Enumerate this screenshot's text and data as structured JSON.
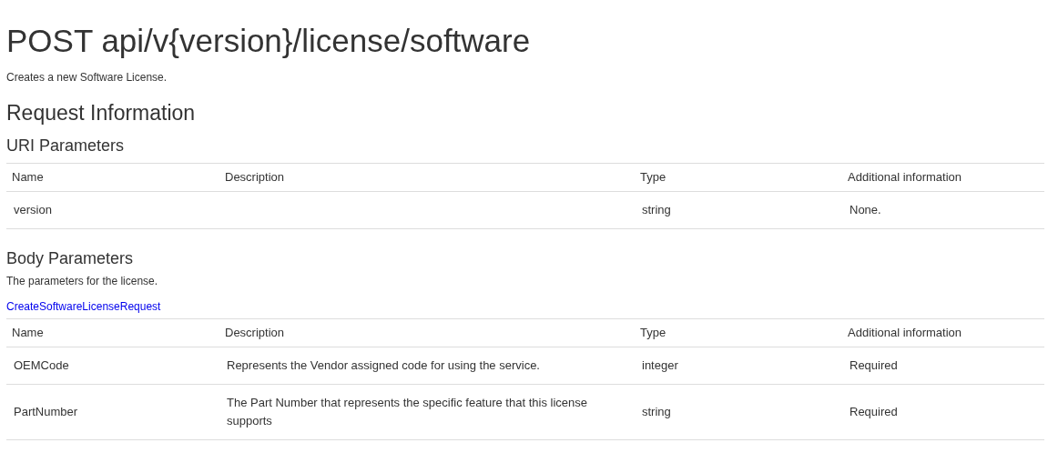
{
  "title": "POST api/v{version}/license/software",
  "description": "Creates a new Software License.",
  "request_heading": "Request Information",
  "uri_parameters": {
    "heading": "URI Parameters",
    "columns": [
      "Name",
      "Description",
      "Type",
      "Additional information"
    ],
    "rows": [
      [
        "version",
        "",
        "string",
        "None."
      ]
    ]
  },
  "body_parameters": {
    "heading": "Body Parameters",
    "description": "The parameters for the license.",
    "type_link": "CreateSoftwareLicenseRequest",
    "columns": [
      "Name",
      "Description",
      "Type",
      "Additional information"
    ],
    "rows": [
      [
        "OEMCode",
        "Represents the Vendor assigned code for using the service.",
        "integer",
        "Required"
      ],
      [
        "PartNumber",
        "The Part Number that represents the specific feature that this license supports",
        "string",
        "Required"
      ]
    ]
  }
}
